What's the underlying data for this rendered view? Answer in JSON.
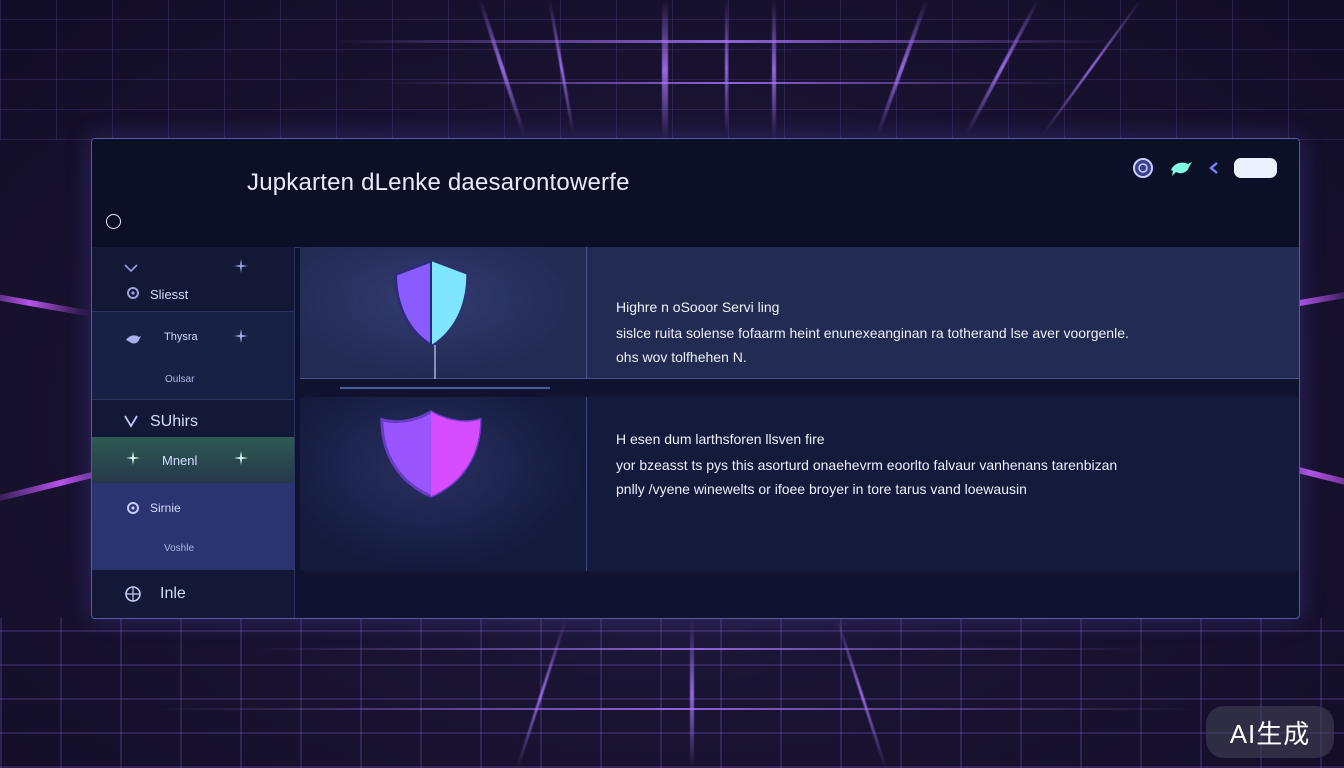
{
  "window": {
    "title": "Jupkarten dLenke daesarontowerfe"
  },
  "sidebar": {
    "items": [
      {
        "label": "Sliesst"
      },
      {
        "label": "Thysra",
        "sub": "Oulsar"
      },
      {
        "label": "SUhirs"
      },
      {
        "label": "Mnenl"
      },
      {
        "label": "Sirnie",
        "sub": "Voshle"
      },
      {
        "label": "Inle"
      }
    ]
  },
  "cards": [
    {
      "heading": "Highre n oSooor Servi ling",
      "lines": [
        "sislce ruita solense fofaarm heint enunexeanginan ra totherand lse aver voorgenle.",
        "ohs wov tolfhehen        N."
      ]
    },
    {
      "heading": "H esen dum larthsforen llsven fire",
      "lines": [
        "yor bzeasst ts pys this asorturd onaehevrm eoorlto falvaur vanhenans tarenbizan",
        "pnlly /vyene winewelts or ifoee broyer in tore tarus vand loewausin"
      ]
    }
  ],
  "watermark": "AI生成",
  "colors": {
    "accent": "#8b6cff",
    "shield_left": "#8a5cff",
    "shield_right": "#7fe6ff",
    "shield2": "#c44dff",
    "panel": "#0f1330"
  }
}
